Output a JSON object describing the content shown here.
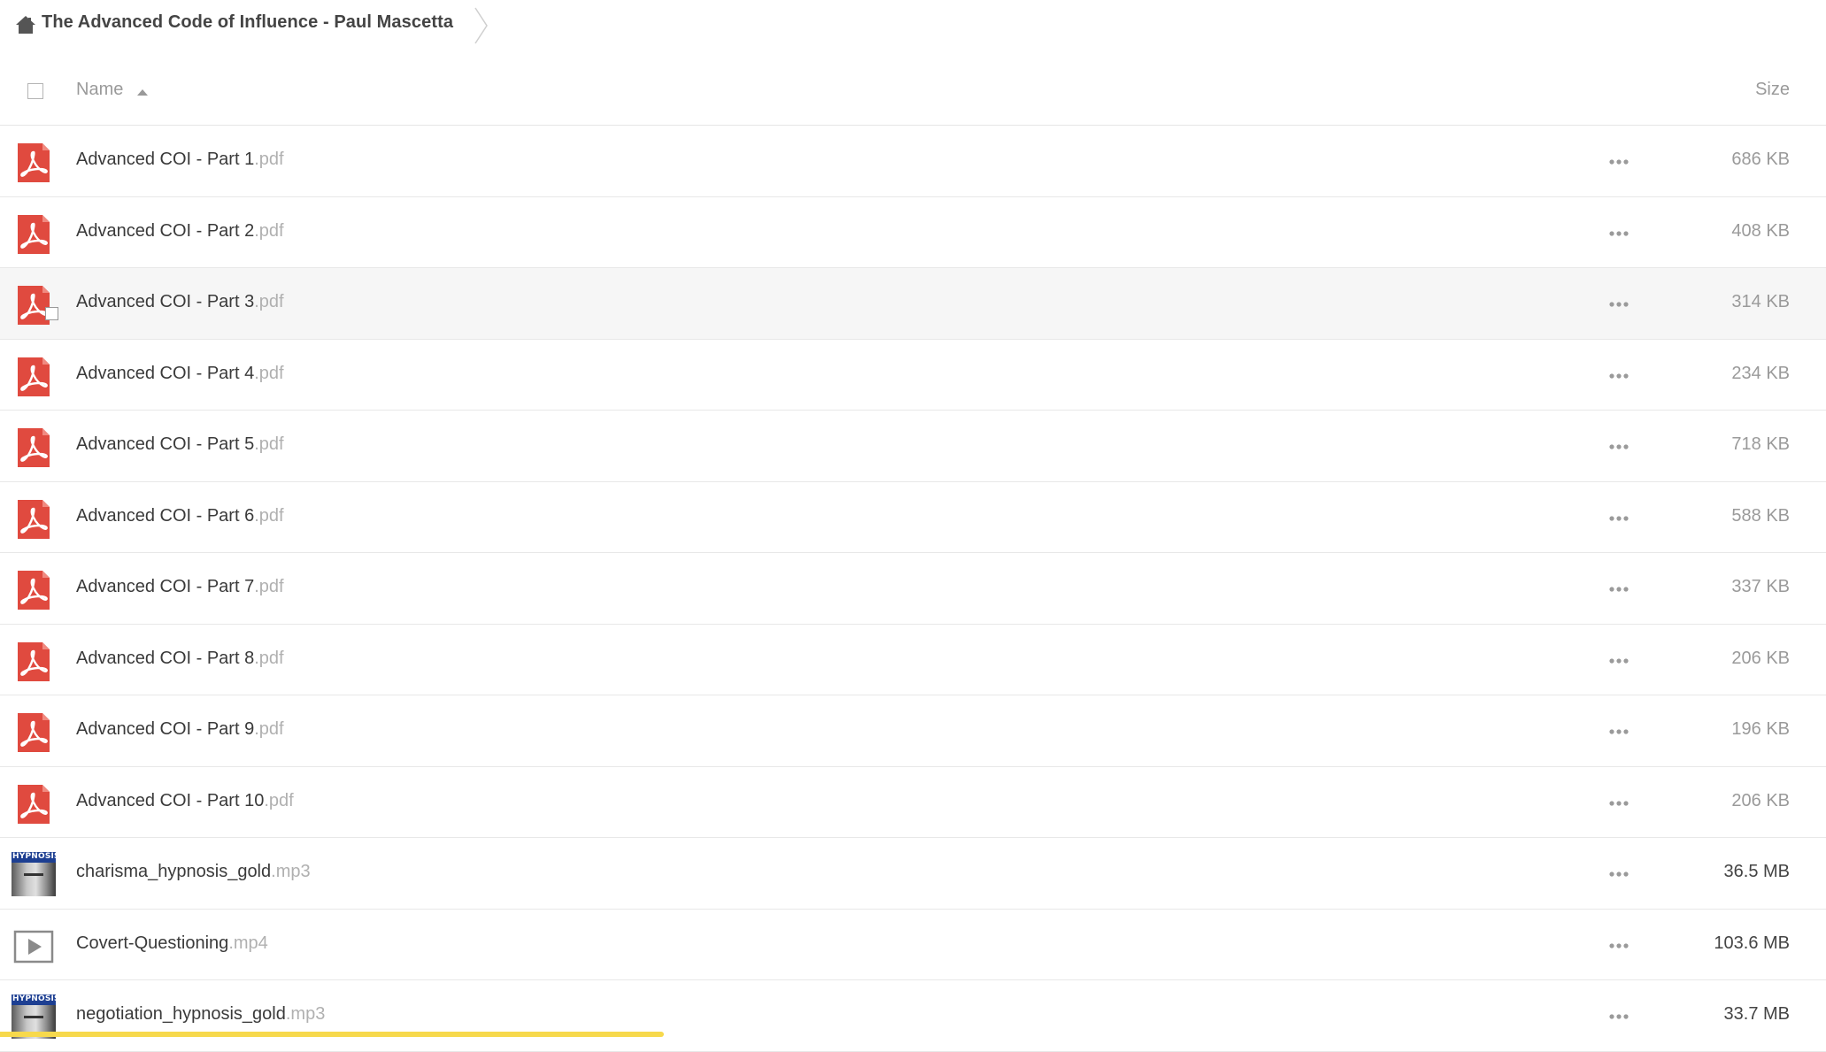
{
  "breadcrumb": {
    "home_icon": "home-icon",
    "title": "The Advanced Code of Influence - Paul Mascetta"
  },
  "header": {
    "name_label": "Name",
    "size_label": "Size",
    "sort_icon": "sort-ascending-icon"
  },
  "files": [
    {
      "base": "Advanced COI - Part 1",
      "ext": ".pdf",
      "size": "686 KB",
      "icon": "pdf-icon"
    },
    {
      "base": "Advanced COI - Part 2",
      "ext": ".pdf",
      "size": "408 KB",
      "icon": "pdf-icon"
    },
    {
      "base": "Advanced COI - Part 3",
      "ext": ".pdf",
      "size": "314 KB",
      "icon": "pdf-icon"
    },
    {
      "base": "Advanced COI - Part 4",
      "ext": ".pdf",
      "size": "234 KB",
      "icon": "pdf-icon"
    },
    {
      "base": "Advanced COI - Part 5",
      "ext": ".pdf",
      "size": "718 KB",
      "icon": "pdf-icon"
    },
    {
      "base": "Advanced COI - Part 6",
      "ext": ".pdf",
      "size": "588 KB",
      "icon": "pdf-icon"
    },
    {
      "base": "Advanced COI - Part 7",
      "ext": ".pdf",
      "size": "337 KB",
      "icon": "pdf-icon"
    },
    {
      "base": "Advanced COI - Part 8",
      "ext": ".pdf",
      "size": "206 KB",
      "icon": "pdf-icon"
    },
    {
      "base": "Advanced COI - Part 9",
      "ext": ".pdf",
      "size": "196 KB",
      "icon": "pdf-icon"
    },
    {
      "base": "Advanced COI - Part 10",
      "ext": ".pdf",
      "size": "206 KB",
      "icon": "pdf-icon"
    },
    {
      "base": "charisma_hypnosis_gold",
      "ext": ".mp3",
      "size": "36.5 MB",
      "icon": "audio-thumbnail",
      "thumb_label": "HYPNOSIS"
    },
    {
      "base": "Covert-Questioning",
      "ext": ".mp4",
      "size": "103.6 MB",
      "icon": "video-icon"
    },
    {
      "base": "negotiation_hypnosis_gold",
      "ext": ".mp3",
      "size": "33.7 MB",
      "icon": "audio-thumbnail",
      "thumb_label": "HYPNOSIS"
    }
  ],
  "colors": {
    "pdf_red": "#e04a3f",
    "text_muted": "#9a9a9a",
    "toast_yellow": "#f7d94c"
  }
}
